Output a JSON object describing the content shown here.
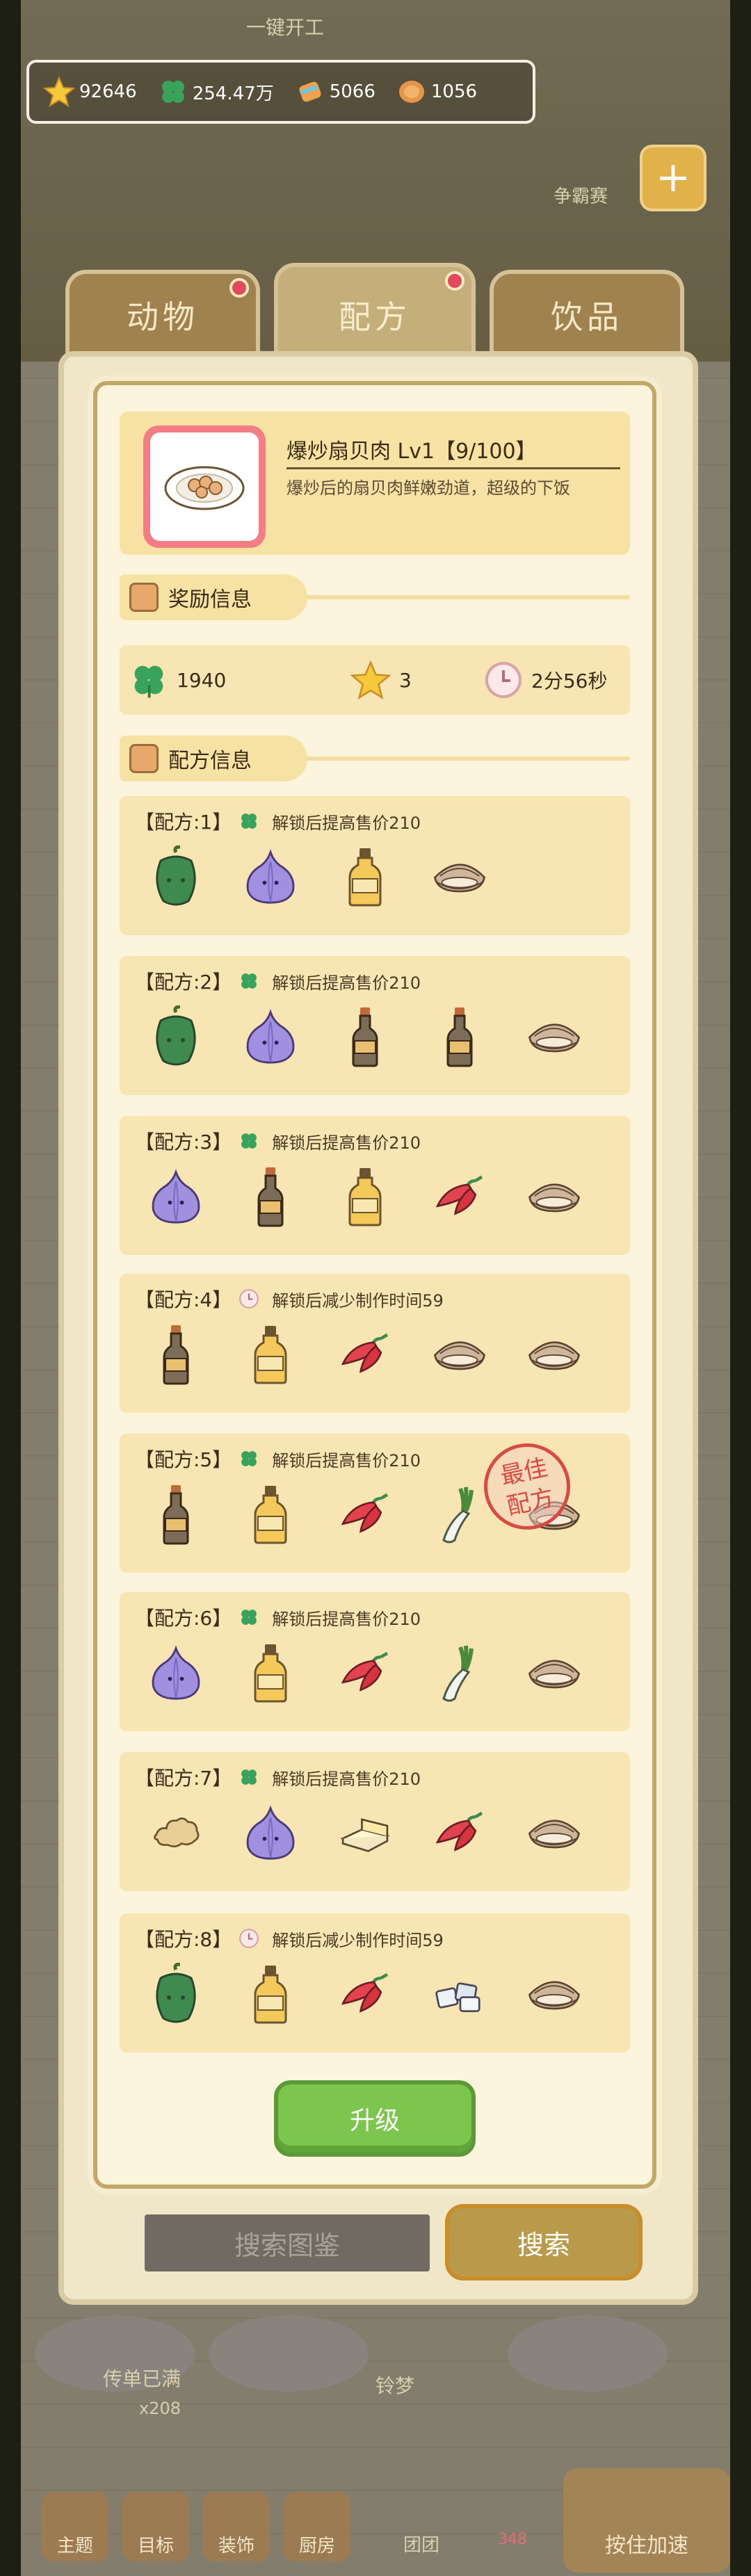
{
  "topbar": {
    "one_key_label": "一键开工"
  },
  "resources": [
    {
      "icon": "star-icon",
      "value": "92646",
      "color": "#f6c93a"
    },
    {
      "icon": "clover-icon",
      "value": "254.47万",
      "color": "#3aa35b"
    },
    {
      "icon": "candy-icon",
      "value": "5066",
      "color": "#f0a24a"
    },
    {
      "icon": "coin-icon",
      "value": "1056",
      "color": "#e8954a"
    }
  ],
  "side": {
    "contest_label": "争霸赛"
  },
  "tabs": [
    {
      "label": "动物",
      "active": false,
      "badge": true
    },
    {
      "label": "配方",
      "active": true,
      "badge": true
    },
    {
      "label": "饮品",
      "active": false,
      "badge": false
    }
  ],
  "dish": {
    "title": "爆炒扇贝肉 Lv1【9/100】",
    "description": "爆炒后的扇贝肉鲜嫩劲道，超级的下饭"
  },
  "reward_section": {
    "title": "奖励信息",
    "clover": "1940",
    "stars": "3",
    "time": "2分56秒"
  },
  "recipe_section": {
    "title": "配方信息"
  },
  "recipes": [
    {
      "label": "【配方:1】",
      "bonus_icon": "clover-icon",
      "bonus": "解锁后提高售价210",
      "ingredients": [
        "green-pepper-icon",
        "onion-icon",
        "oil-bottle-icon",
        "clam-icon"
      ],
      "best": false
    },
    {
      "label": "【配方:2】",
      "bonus_icon": "clover-icon",
      "bonus": "解锁后提高售价210",
      "ingredients": [
        "green-pepper-icon",
        "onion-icon",
        "soy-sauce-icon",
        "soy-sauce-icon",
        "clam-icon"
      ],
      "best": false
    },
    {
      "label": "【配方:3】",
      "bonus_icon": "clover-icon",
      "bonus": "解锁后提高售价210",
      "ingredients": [
        "onion-icon",
        "soy-sauce-icon",
        "oil-bottle-icon",
        "chili-icon",
        "clam-icon"
      ],
      "best": false
    },
    {
      "label": "【配方:4】",
      "bonus_icon": "clock-icon",
      "bonus": "解锁后减少制作时间59",
      "ingredients": [
        "soy-sauce-icon",
        "oil-bottle-icon",
        "chili-icon",
        "clam-icon",
        "clam-icon"
      ],
      "best": false
    },
    {
      "label": "【配方:5】",
      "bonus_icon": "clover-icon",
      "bonus": "解锁后提高售价210",
      "ingredients": [
        "soy-sauce-icon",
        "oil-bottle-icon",
        "chili-icon",
        "leek-icon",
        "clam-icon"
      ],
      "best": true,
      "best_label_1": "最佳",
      "best_label_2": "配方"
    },
    {
      "label": "【配方:6】",
      "bonus_icon": "clover-icon",
      "bonus": "解锁后提高售价210",
      "ingredients": [
        "onion-icon",
        "oil-bottle-icon",
        "chili-icon",
        "leek-icon",
        "clam-icon"
      ],
      "best": false
    },
    {
      "label": "【配方:7】",
      "bonus_icon": "clover-icon",
      "bonus": "解锁后提高售价210",
      "ingredients": [
        "ginger-icon",
        "onion-icon",
        "butter-icon",
        "chili-icon",
        "clam-icon"
      ],
      "best": false
    },
    {
      "label": "【配方:8】",
      "bonus_icon": "clock-icon",
      "bonus": "解锁后减少制作时间59",
      "ingredients": [
        "green-pepper-icon",
        "oil-bottle-icon",
        "chili-icon",
        "ice-cubes-icon",
        "clam-icon"
      ],
      "best": false
    }
  ],
  "upgrade_label": "升级",
  "search": {
    "placeholder": "搜索图鉴",
    "button_label": "搜索"
  },
  "bottom": {
    "rumor_label": "传单已满",
    "count_label": "x208",
    "user_label": "铃梦",
    "nav": [
      "主题",
      "目标",
      "装饰",
      "厨房"
    ],
    "group_label": "团团",
    "temp_label": "348",
    "speed_label": "按住加速"
  }
}
